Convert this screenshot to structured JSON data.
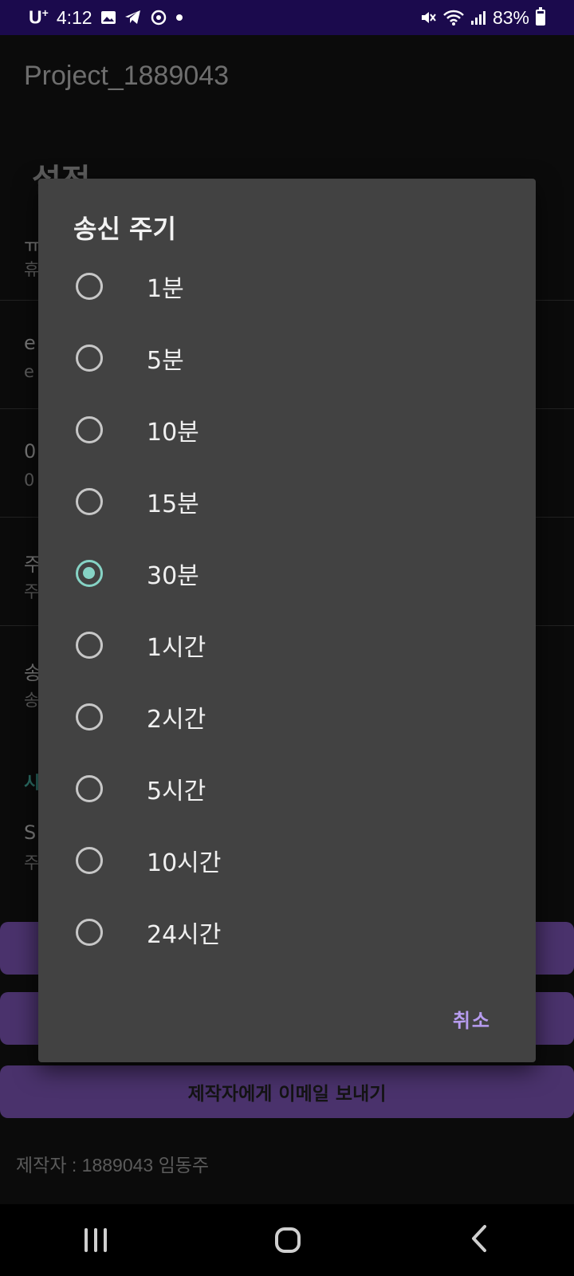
{
  "status_bar": {
    "carrier": "U",
    "carrier_sup": "+",
    "time": "4:12",
    "battery": "83%"
  },
  "app": {
    "title": "Project_1889043",
    "heading": "설정",
    "rows": [
      {
        "title": "ㅠ",
        "sub": "휴"
      },
      {
        "title": "e",
        "sub": "e"
      },
      {
        "title": "0",
        "sub": "0"
      },
      {
        "title": "주",
        "sub": "주"
      },
      {
        "title": "송",
        "sub": "송"
      }
    ],
    "section": "시",
    "row_s": {
      "title": "S",
      "sub": "주"
    },
    "email_button": "제작자에게 이메일 보내기",
    "credit": "제작자 : 1889043 임동주"
  },
  "dialog": {
    "title": "송신 주기",
    "options": [
      {
        "label": "1분",
        "selected": false
      },
      {
        "label": "5분",
        "selected": false
      },
      {
        "label": "10분",
        "selected": false
      },
      {
        "label": "15분",
        "selected": false
      },
      {
        "label": "30분",
        "selected": true
      },
      {
        "label": "1시간",
        "selected": false
      },
      {
        "label": "2시간",
        "selected": false
      },
      {
        "label": "5시간",
        "selected": false
      },
      {
        "label": "10시간",
        "selected": false
      },
      {
        "label": "24시간",
        "selected": false
      }
    ],
    "cancel": "취소"
  },
  "colors": {
    "accent": "#86d3c5",
    "cancel": "#b79cf0",
    "dialog_bg": "#424242",
    "status_bar": "#1b0a4d"
  }
}
